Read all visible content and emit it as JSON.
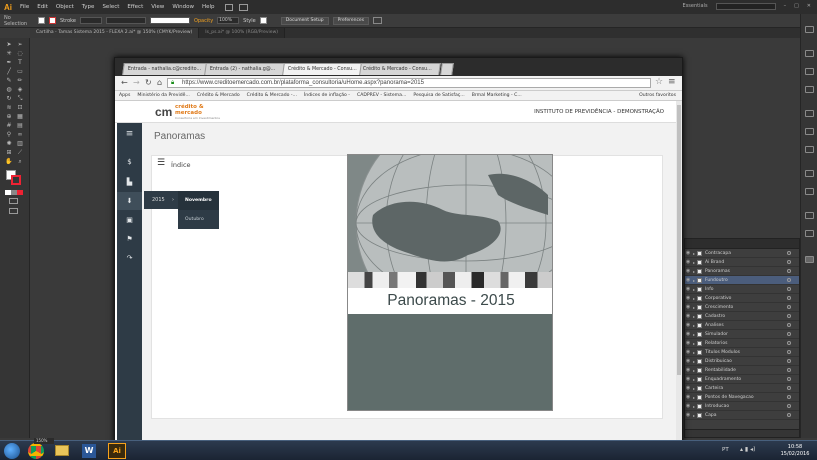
{
  "illustrator": {
    "logo": "Ai",
    "menu": [
      "File",
      "Edit",
      "Object",
      "Type",
      "Select",
      "Effect",
      "View",
      "Window",
      "Help"
    ],
    "workspace": "Essentials",
    "control_bar": {
      "selection": "No Selection",
      "stroke_label": "Stroke",
      "opacity_label": "Opacity",
      "opacity_value": "100%",
      "style_label": "Style",
      "document_setup": "Document Setup",
      "preferences": "Preferences"
    },
    "doc_tabs": [
      "Cartilha - Tamas Sistema 2015 - FLEXA 2.ai* @ 150% (CMYK/Preview)",
      "Is_ps.ai* @ 100% (RGB/Preview)"
    ],
    "layers": [
      "Contracapa",
      "Ai Brand",
      "Panoramas",
      "Fundoutro",
      "Info",
      "Corporativo",
      "Crescimento",
      "Cadastro",
      "Analises",
      "Simulador",
      "Relatorios",
      "Titulos Modulos",
      "Distribuicao",
      "Rentabilidade",
      "Enquadramento",
      "Carteira",
      "Pontos de Navegacao",
      "Introducao",
      "Capa"
    ],
    "selected_layer": "Fundoutro",
    "zoom": "150%"
  },
  "browser": {
    "tabs": [
      "Entrada - nathalia.c@credito...",
      "Entrada (2) - nathalia.g@...",
      "Crédito & Mercado - Consu...",
      "Crédito & Mercado - Consu..."
    ],
    "url": "https://www.creditoemercado.com.br/plataforma_consultoria/uHome.aspx?panorama=2015",
    "bookmarks": [
      "Apps",
      "Ministério da Previdê...",
      "Crédito & Mercado",
      "Crédito & Mercado -...",
      "Índices de inflação -",
      "CADPREV - Sistema...",
      "Pesquisa de Satisfaç...",
      "Brmal Marketing - C...",
      "Outros favoritos"
    ]
  },
  "site": {
    "logo_main": "crédito & mercado",
    "logo_sub": "Consultoria em Investimentos",
    "institute": "INSTITUTO DE PREVIDÊNCIA - DEMONSTRAÇÃO",
    "page_title": "Panoramas",
    "index_label": "Índice",
    "year": "2015",
    "months": [
      "Novembro",
      "Outubro"
    ],
    "cover_title": "Panoramas - 2015"
  },
  "taskbar": {
    "lang": "PT",
    "time": "10:58",
    "date": "15/02/2016"
  }
}
